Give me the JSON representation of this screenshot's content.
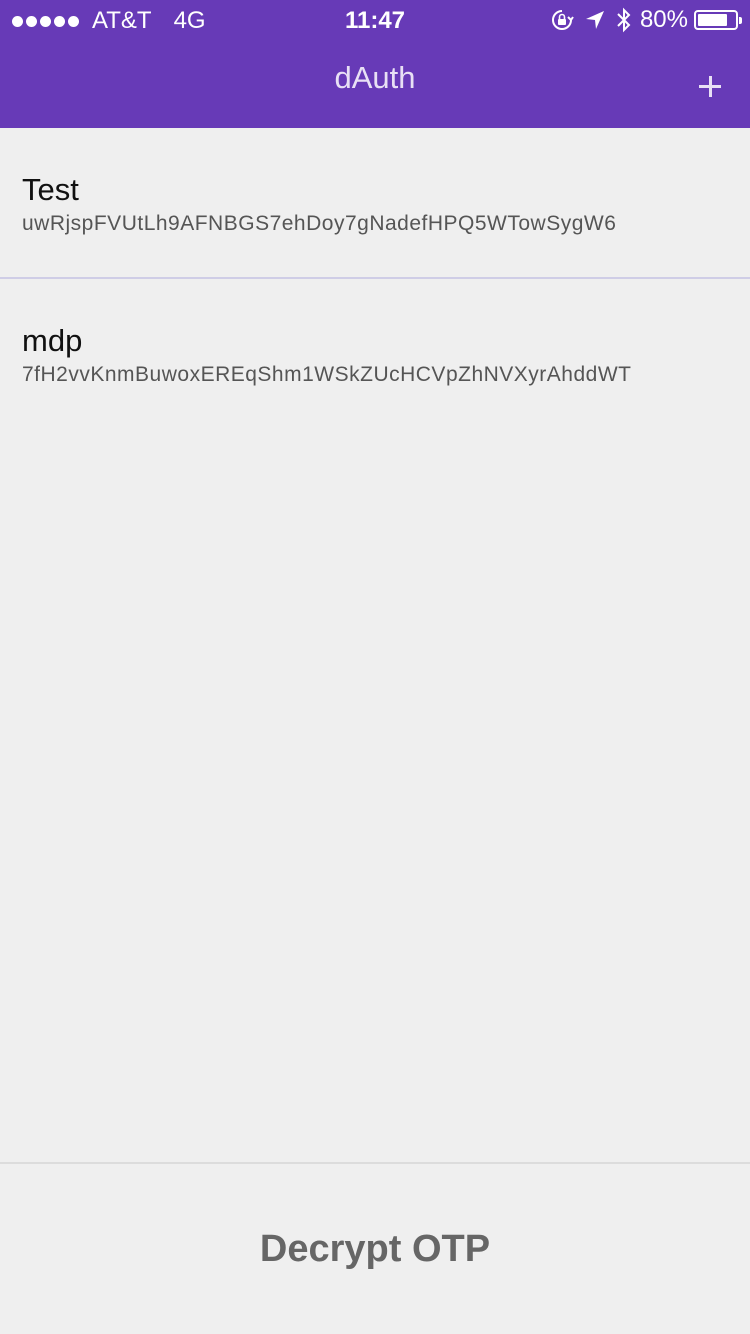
{
  "status_bar": {
    "carrier": "AT&T",
    "network": "4G",
    "time": "11:47",
    "battery_percent": "80%",
    "icons": [
      "signal-dots-icon",
      "orientation-lock-icon",
      "location-arrow-icon",
      "bluetooth-icon",
      "battery-icon"
    ]
  },
  "nav": {
    "title": "dAuth",
    "add_icon": "plus-icon"
  },
  "accounts": [
    {
      "name": "Test",
      "secret": "uwRjspFVUtLh9AFNBGS7ehDoy7gNadefHPQ5WTowSygW6"
    },
    {
      "name": "mdp",
      "secret": "7fH2vvKnmBuwoxEREqShm1WSkZUcHCVpZhNVXyrAhddWT"
    }
  ],
  "footer": {
    "decrypt_label": "Decrypt OTP"
  },
  "colors": {
    "header": "#673ab7",
    "background": "#efefef",
    "divider": "#cfcde6"
  }
}
